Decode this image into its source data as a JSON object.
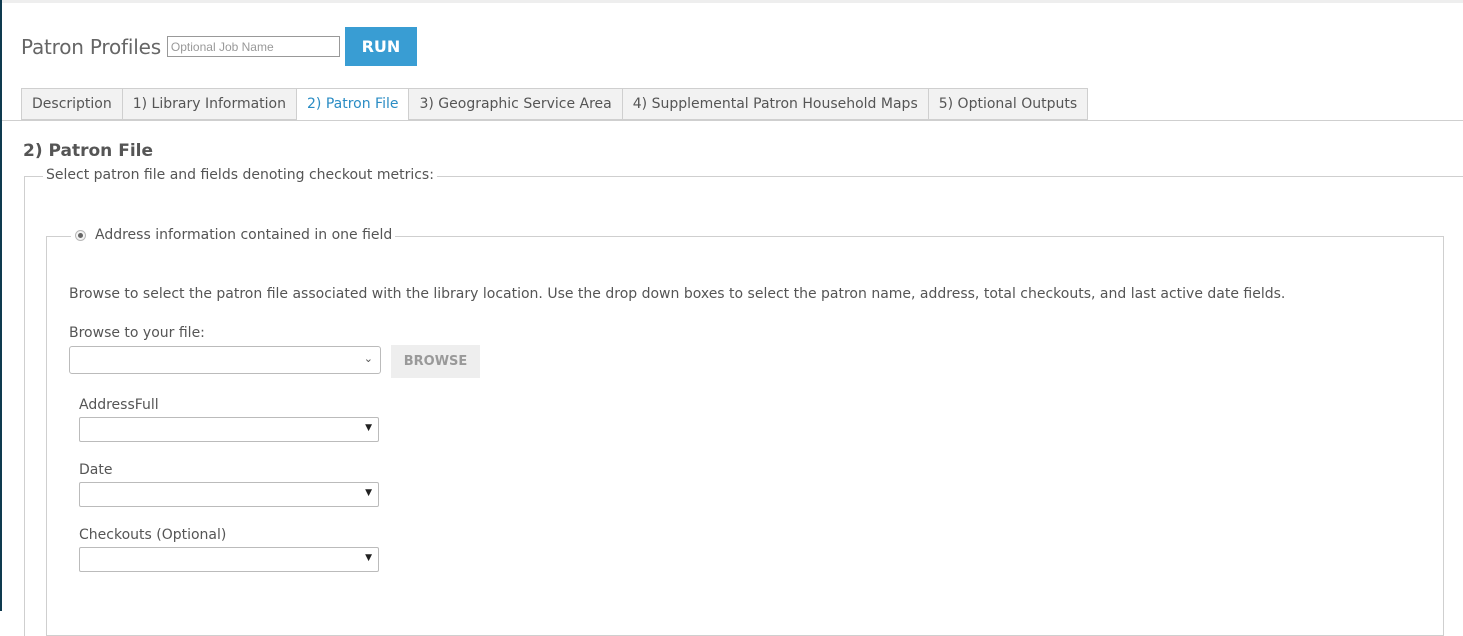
{
  "header": {
    "title": "Patron Profiles",
    "job_name_placeholder": "Optional Job Name",
    "job_name_value": "",
    "run_label": "RUN"
  },
  "colors": {
    "accent": "#399dd3",
    "active_tab_text": "#2a8cc4",
    "left_strip": "#0e3a4f"
  },
  "tabs": [
    {
      "label": "Description",
      "active": false
    },
    {
      "label": "1) Library Information",
      "active": false
    },
    {
      "label": "2) Patron File",
      "active": true
    },
    {
      "label": "3) Geographic Service Area",
      "active": false
    },
    {
      "label": "4) Supplemental Patron Household Maps",
      "active": false
    },
    {
      "label": "5) Optional Outputs",
      "active": false
    }
  ],
  "section": {
    "title": "2) Patron File",
    "outer_legend": "Select patron file and fields denoting checkout metrics:",
    "radio_option": {
      "label": "Address information contained in one field",
      "selected": true
    },
    "description": "Browse to select the patron file associated with the library location. Use the drop down boxes to select the patron name, address, total checkouts, and last active date fields.",
    "browse_label": "Browse to your file:",
    "file_value": "",
    "browse_button": "BROWSE",
    "fields": [
      {
        "label": "AddressFull",
        "value": ""
      },
      {
        "label": "Date",
        "value": ""
      },
      {
        "label": "Checkouts (Optional)",
        "value": ""
      }
    ]
  }
}
